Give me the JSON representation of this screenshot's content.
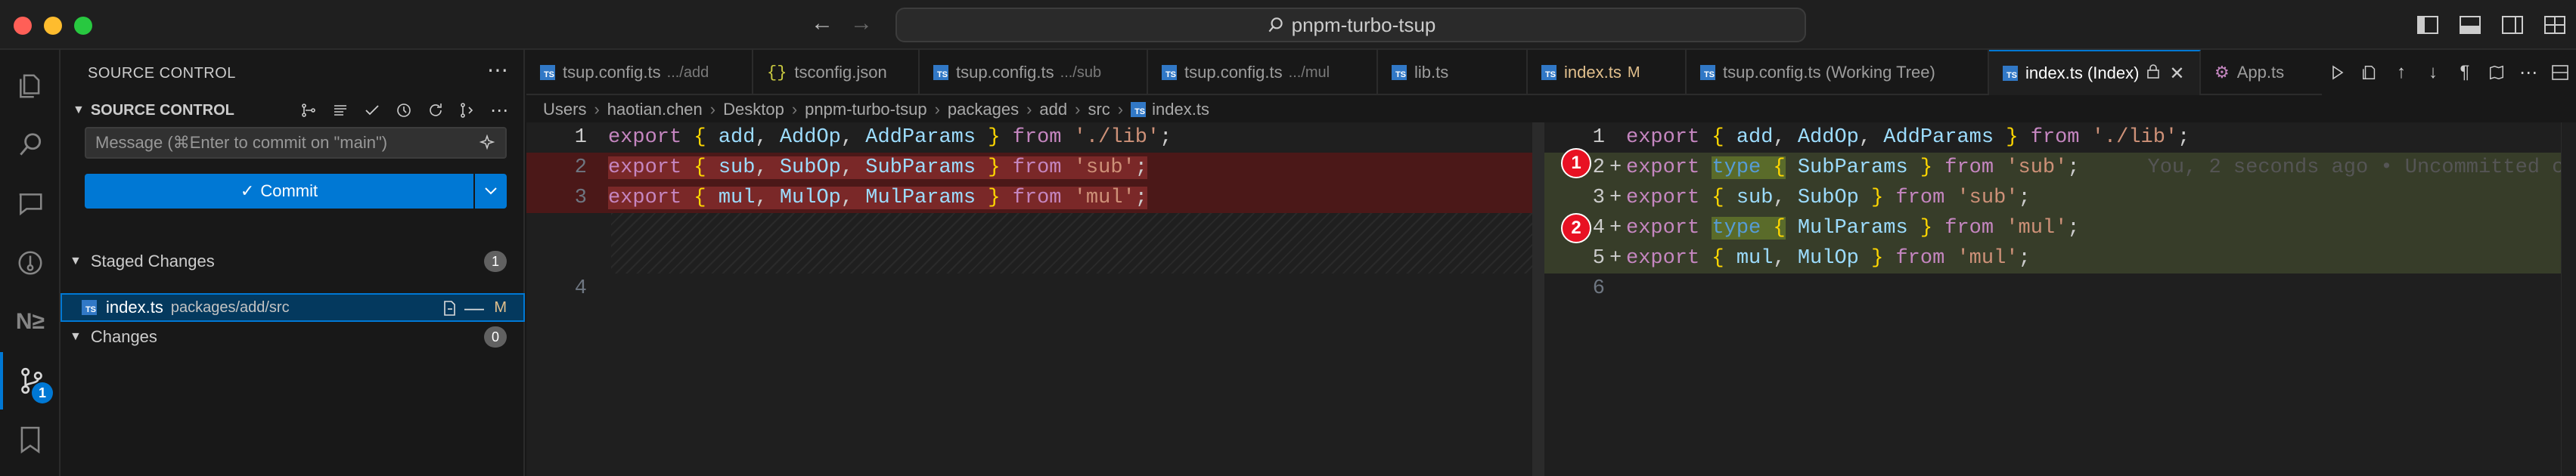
{
  "window": {
    "title": "pnpm-turbo-tsup",
    "traffic_colors": [
      "#ff5f57",
      "#febc2e",
      "#28c840"
    ],
    "accent": "#0078d4"
  },
  "activity_bar": {
    "items": [
      {
        "name": "explorer-icon"
      },
      {
        "name": "search-icon"
      },
      {
        "name": "chat-icon"
      },
      {
        "name": "gitlens-icon"
      },
      {
        "name": "nx-icon",
        "label": "N≥"
      },
      {
        "name": "source-control-icon",
        "badge": "1"
      },
      {
        "name": "bookmarks-icon"
      }
    ]
  },
  "sidebar": {
    "header": "SOURCE CONTROL",
    "section_title": "SOURCE CONTROL",
    "message_placeholder": "Message (⌘Enter to commit on \"main\")",
    "commit_label": "Commit",
    "staged": {
      "label": "Staged Changes",
      "count": "1",
      "files": [
        {
          "name": "index.ts",
          "path": "packages/add/src",
          "status": "M"
        }
      ]
    },
    "changes": {
      "label": "Changes",
      "count": "0"
    }
  },
  "tabs": [
    {
      "label": "tsup.config.ts",
      "desc": ".../add"
    },
    {
      "label": "tsconfig.json",
      "desc": ""
    },
    {
      "label": "tsup.config.ts",
      "desc": ".../sub"
    },
    {
      "label": "tsup.config.ts",
      "desc": ".../mul"
    },
    {
      "label": "lib.ts",
      "desc": ""
    },
    {
      "label": "index.ts",
      "desc": "M"
    },
    {
      "label": "tsup.config.ts (Working Tree)",
      "desc": ""
    },
    {
      "label": "index.ts (Index)",
      "desc": ""
    },
    {
      "label": "App.ts",
      "desc": ""
    }
  ],
  "breadcrumb": [
    "Users",
    "haotian.chen",
    "Desktop",
    "pnpm-turbo-tsup",
    "packages",
    "add",
    "src",
    "index.ts"
  ],
  "left_editor": {
    "line_numbers": [
      "1",
      "2",
      "3",
      "4"
    ]
  },
  "right_editor": {
    "line_numbers": [
      "1",
      "2",
      "3",
      "4",
      "5",
      "6"
    ],
    "blame": "You, 2 seconds ago • Uncommitted c"
  },
  "markers": [
    "1",
    "2"
  ],
  "code": {
    "export": "export",
    "type": "type",
    "from": "from",
    "add": "add",
    "AddOp": "AddOp",
    "AddParams": "AddParams",
    "sub": "sub",
    "SubOp": "SubOp",
    "SubParams": "SubParams",
    "mul": "mul",
    "MulOp": "MulOp",
    "MulParams": "MulParams",
    "lib_path": "'./lib'",
    "sub_path": "'sub'",
    "mul_path": "'mul'",
    "open_brace": "{",
    "close_brace": "}",
    "comma": ",",
    "semicolon": ";"
  }
}
